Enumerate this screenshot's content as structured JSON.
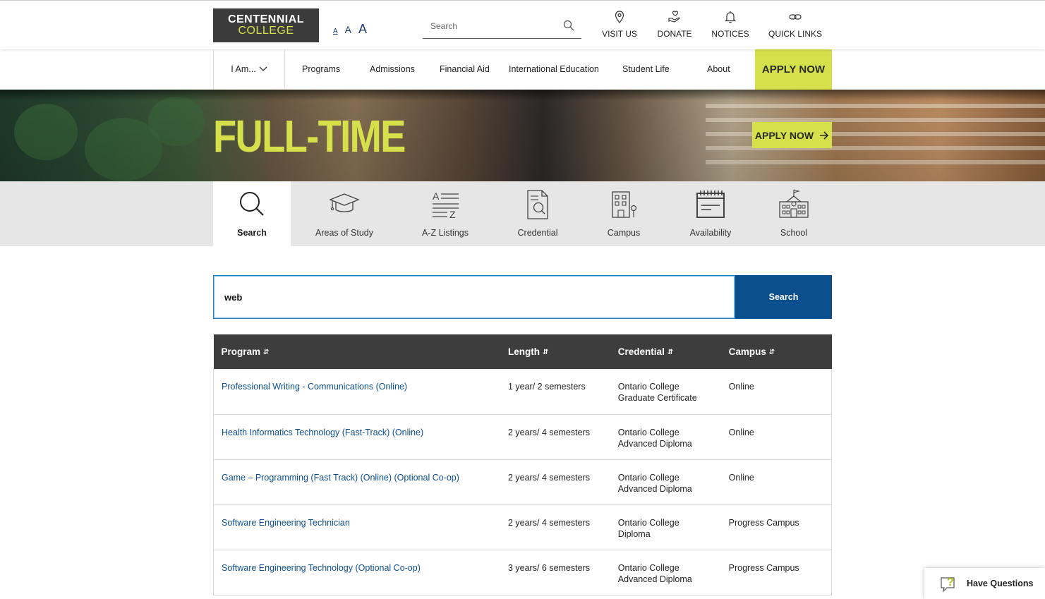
{
  "header": {
    "logo_line1": "CENTENNIAL",
    "logo_line2": "COLLEGE",
    "text_size": [
      "A",
      "A",
      "A"
    ],
    "search_placeholder": "Search",
    "utilities": [
      {
        "label": "VISIT US",
        "icon": "map-pin-icon"
      },
      {
        "label": "DONATE",
        "icon": "donate-hand-heart-icon"
      },
      {
        "label": "NOTICES",
        "icon": "bell-icon"
      },
      {
        "label": "QUICK LINKS",
        "icon": "link-icon"
      }
    ]
  },
  "nav": {
    "iam": "I Am...",
    "items": [
      "Programs",
      "Admissions",
      "Financial Aid",
      "International Education",
      "Student Life",
      "About"
    ],
    "apply": "APPLY NOW"
  },
  "hero": {
    "title": "FULL-TIME",
    "apply": "APPLY NOW"
  },
  "filters": {
    "tabs": [
      {
        "label": "Search",
        "icon": "search-icon",
        "active": true
      },
      {
        "label": "Areas of Study",
        "icon": "graduation-cap-icon",
        "active": false
      },
      {
        "label": "A-Z Listings",
        "icon": "az-list-icon",
        "active": false
      },
      {
        "label": "Credential",
        "icon": "credential-document-icon",
        "active": false
      },
      {
        "label": "Campus",
        "icon": "campus-building-icon",
        "active": false
      },
      {
        "label": "Availability",
        "icon": "calendar-icon",
        "active": false
      },
      {
        "label": "School",
        "icon": "school-building-icon",
        "active": false
      }
    ]
  },
  "program_search": {
    "value": "web",
    "button": "Search"
  },
  "table": {
    "headers": [
      "Program",
      "Length",
      "Credential",
      "Campus"
    ],
    "rows": [
      {
        "program": "Professional Writing - Communications (Online)",
        "length": "1 year/ 2 semesters",
        "credential_1": "Ontario College",
        "credential_2": "Graduate Certificate",
        "campus": "Online"
      },
      {
        "program": "Health Informatics Technology (Fast-Track) (Online)",
        "length": "2 years/ 4 semesters",
        "credential_1": "Ontario College",
        "credential_2": "Advanced Diploma",
        "campus": "Online"
      },
      {
        "program": "Game – Programming (Fast Track) (Online) (Optional Co-op)",
        "length": "2 years/ 4 semesters",
        "credential_1": "Ontario College",
        "credential_2": "Advanced Diploma",
        "campus": "Online"
      },
      {
        "program": "Software Engineering Technician",
        "length": "2 years/ 4 semesters",
        "credential_1": "Ontario College",
        "credential_2": "Diploma",
        "campus": "Progress Campus"
      },
      {
        "program": "Software Engineering Technology (Optional Co-op)",
        "length": "3 years/ 6 semesters",
        "credential_1": "Ontario College",
        "credential_2": "Advanced Diploma",
        "campus": "Progress Campus"
      }
    ]
  },
  "chat": {
    "label": "Have Questions"
  },
  "colors": {
    "accent_lime": "#d5e04b",
    "navy_button": "#0c4f8f",
    "table_header": "#3d3d3d",
    "link": "#0c4f8f"
  }
}
